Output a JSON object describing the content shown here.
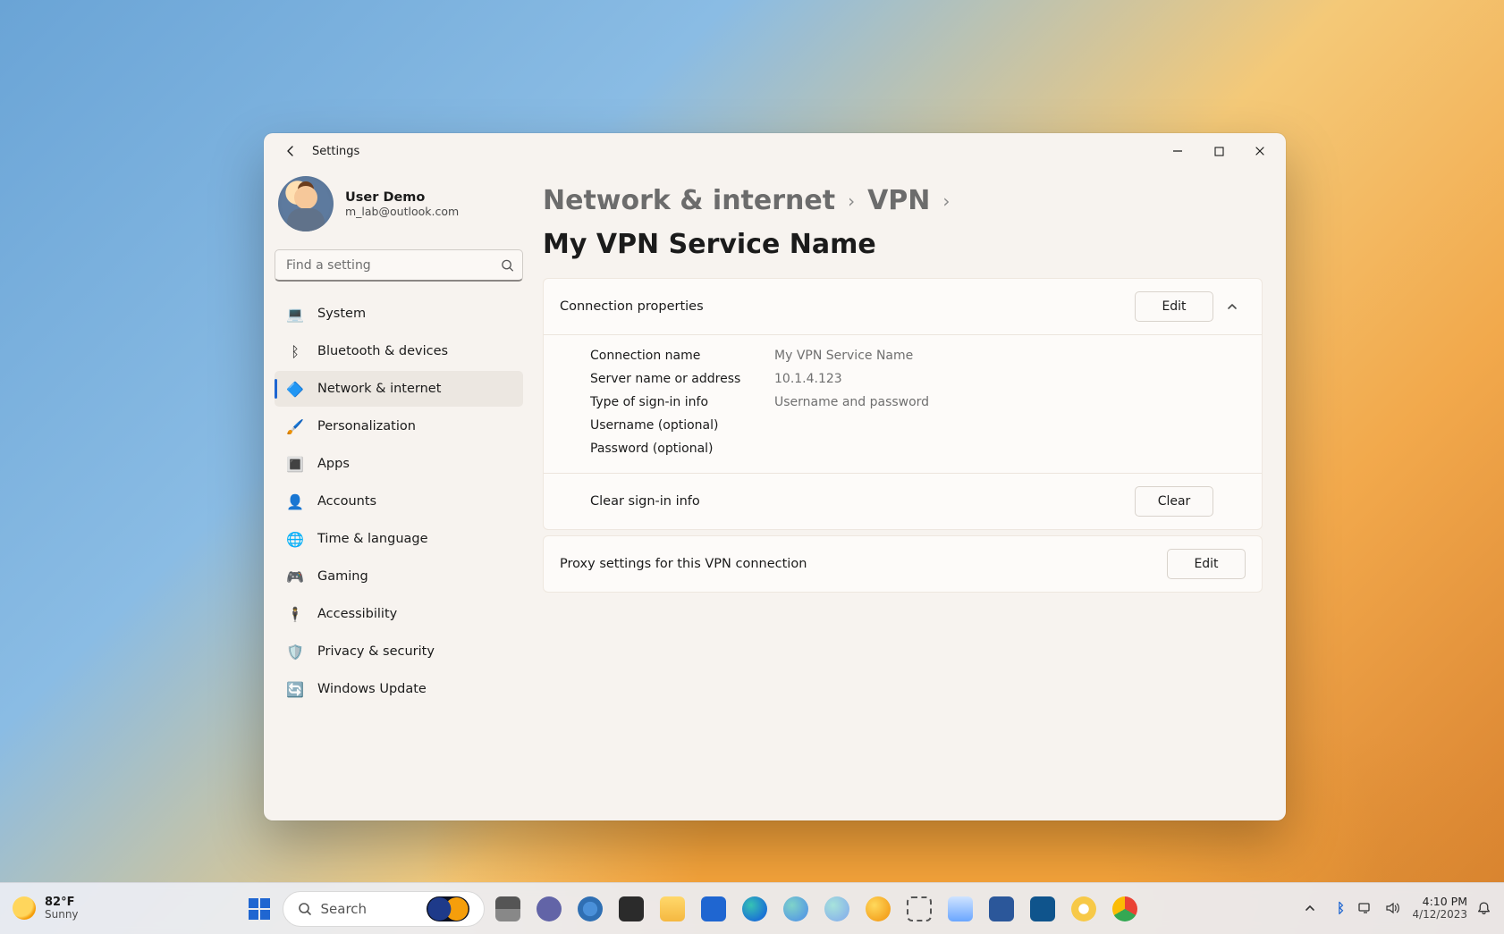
{
  "window": {
    "app_title": "Settings",
    "back_tooltip": "Back"
  },
  "profile": {
    "display_name": "User Demo",
    "email": "m_lab@outlook.com"
  },
  "search": {
    "placeholder": "Find a setting"
  },
  "sidebar": {
    "items": [
      {
        "id": "system",
        "label": "System",
        "icon": "💻"
      },
      {
        "id": "bluetooth",
        "label": "Bluetooth & devices",
        "icon": "ᛒ"
      },
      {
        "id": "network",
        "label": "Network & internet",
        "icon": "🔷"
      },
      {
        "id": "personalization",
        "label": "Personalization",
        "icon": "🖌️"
      },
      {
        "id": "apps",
        "label": "Apps",
        "icon": "🔳"
      },
      {
        "id": "accounts",
        "label": "Accounts",
        "icon": "👤"
      },
      {
        "id": "time",
        "label": "Time & language",
        "icon": "🌐"
      },
      {
        "id": "gaming",
        "label": "Gaming",
        "icon": "🎮"
      },
      {
        "id": "accessibility",
        "label": "Accessibility",
        "icon": "🕴️"
      },
      {
        "id": "privacy",
        "label": "Privacy & security",
        "icon": "🛡️"
      },
      {
        "id": "update",
        "label": "Windows Update",
        "icon": "🔄"
      }
    ],
    "active_id": "network"
  },
  "breadcrumb": {
    "part1": "Network & internet",
    "part2": "VPN",
    "current": "My VPN Service Name"
  },
  "cards": {
    "connection": {
      "title": "Connection properties",
      "edit_label": "Edit",
      "rows": [
        {
          "k": "Connection name",
          "v": "My VPN Service Name"
        },
        {
          "k": "Server name or address",
          "v": "10.1.4.123"
        },
        {
          "k": "Type of sign-in info",
          "v": "Username and password"
        },
        {
          "k": "Username (optional)",
          "v": ""
        },
        {
          "k": "Password (optional)",
          "v": ""
        }
      ],
      "clear_title": "Clear sign-in info",
      "clear_label": "Clear"
    },
    "proxy": {
      "title": "Proxy settings for this VPN connection",
      "edit_label": "Edit"
    }
  },
  "taskbar": {
    "weather": {
      "temp": "82°F",
      "condition": "Sunny"
    },
    "search_placeholder": "Search",
    "clock": {
      "time": "4:10 PM",
      "date": "4/12/2023"
    }
  }
}
